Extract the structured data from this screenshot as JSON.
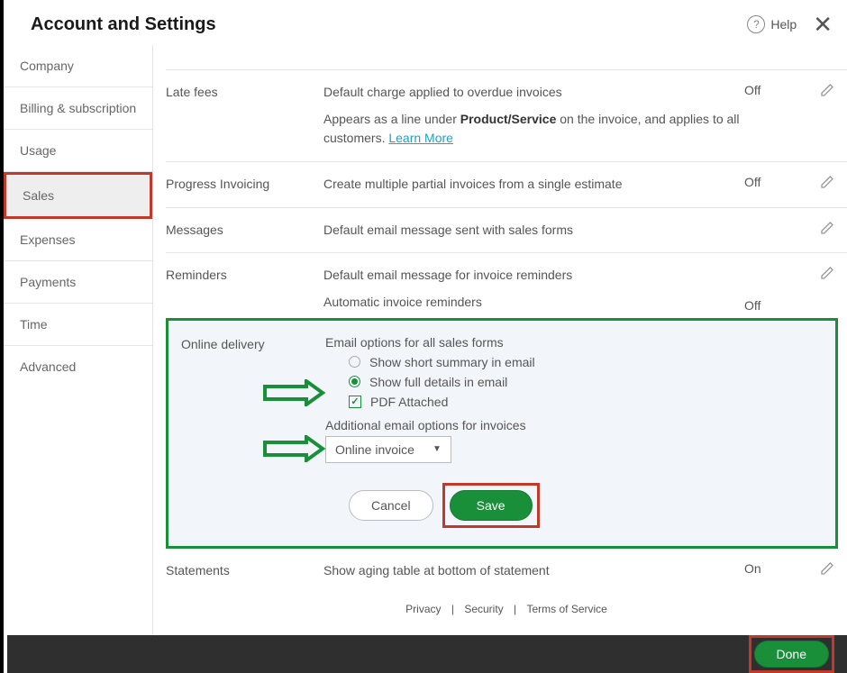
{
  "header": {
    "title": "Account and Settings",
    "help": "Help"
  },
  "sidebar": {
    "items": [
      {
        "label": "Company"
      },
      {
        "label": "Billing & subscription"
      },
      {
        "label": "Usage"
      },
      {
        "label": "Sales"
      },
      {
        "label": "Expenses"
      },
      {
        "label": "Payments"
      },
      {
        "label": "Time"
      },
      {
        "label": "Advanced"
      }
    ]
  },
  "lateFees": {
    "label": "Late fees",
    "desc1": "Default charge applied to overdue invoices",
    "desc2a": "Appears as a line under ",
    "desc2b": "Product/Service",
    "desc2c": " on the invoice, and applies to all customers. ",
    "learn": "Learn More",
    "value": "Off"
  },
  "progress": {
    "label": "Progress Invoicing",
    "desc": "Create multiple partial invoices from a single estimate",
    "value": "Off"
  },
  "messages": {
    "label": "Messages",
    "desc": "Default email message sent with sales forms"
  },
  "reminders": {
    "label": "Reminders",
    "desc1": "Default email message for invoice reminders",
    "desc2": "Automatic invoice reminders",
    "value2": "Off"
  },
  "online": {
    "label": "Online delivery",
    "heading": "Email options for all sales forms",
    "opt1": "Show short summary in email",
    "opt2": "Show full details in email",
    "opt3": "PDF Attached",
    "heading2": "Additional email options for invoices",
    "select": "Online invoice",
    "cancel": "Cancel",
    "save": "Save"
  },
  "statements": {
    "label": "Statements",
    "desc": "Show aging table at bottom of statement",
    "value": "On"
  },
  "footer": {
    "privacy": "Privacy",
    "security": "Security",
    "terms": "Terms of Service",
    "done": "Done"
  }
}
